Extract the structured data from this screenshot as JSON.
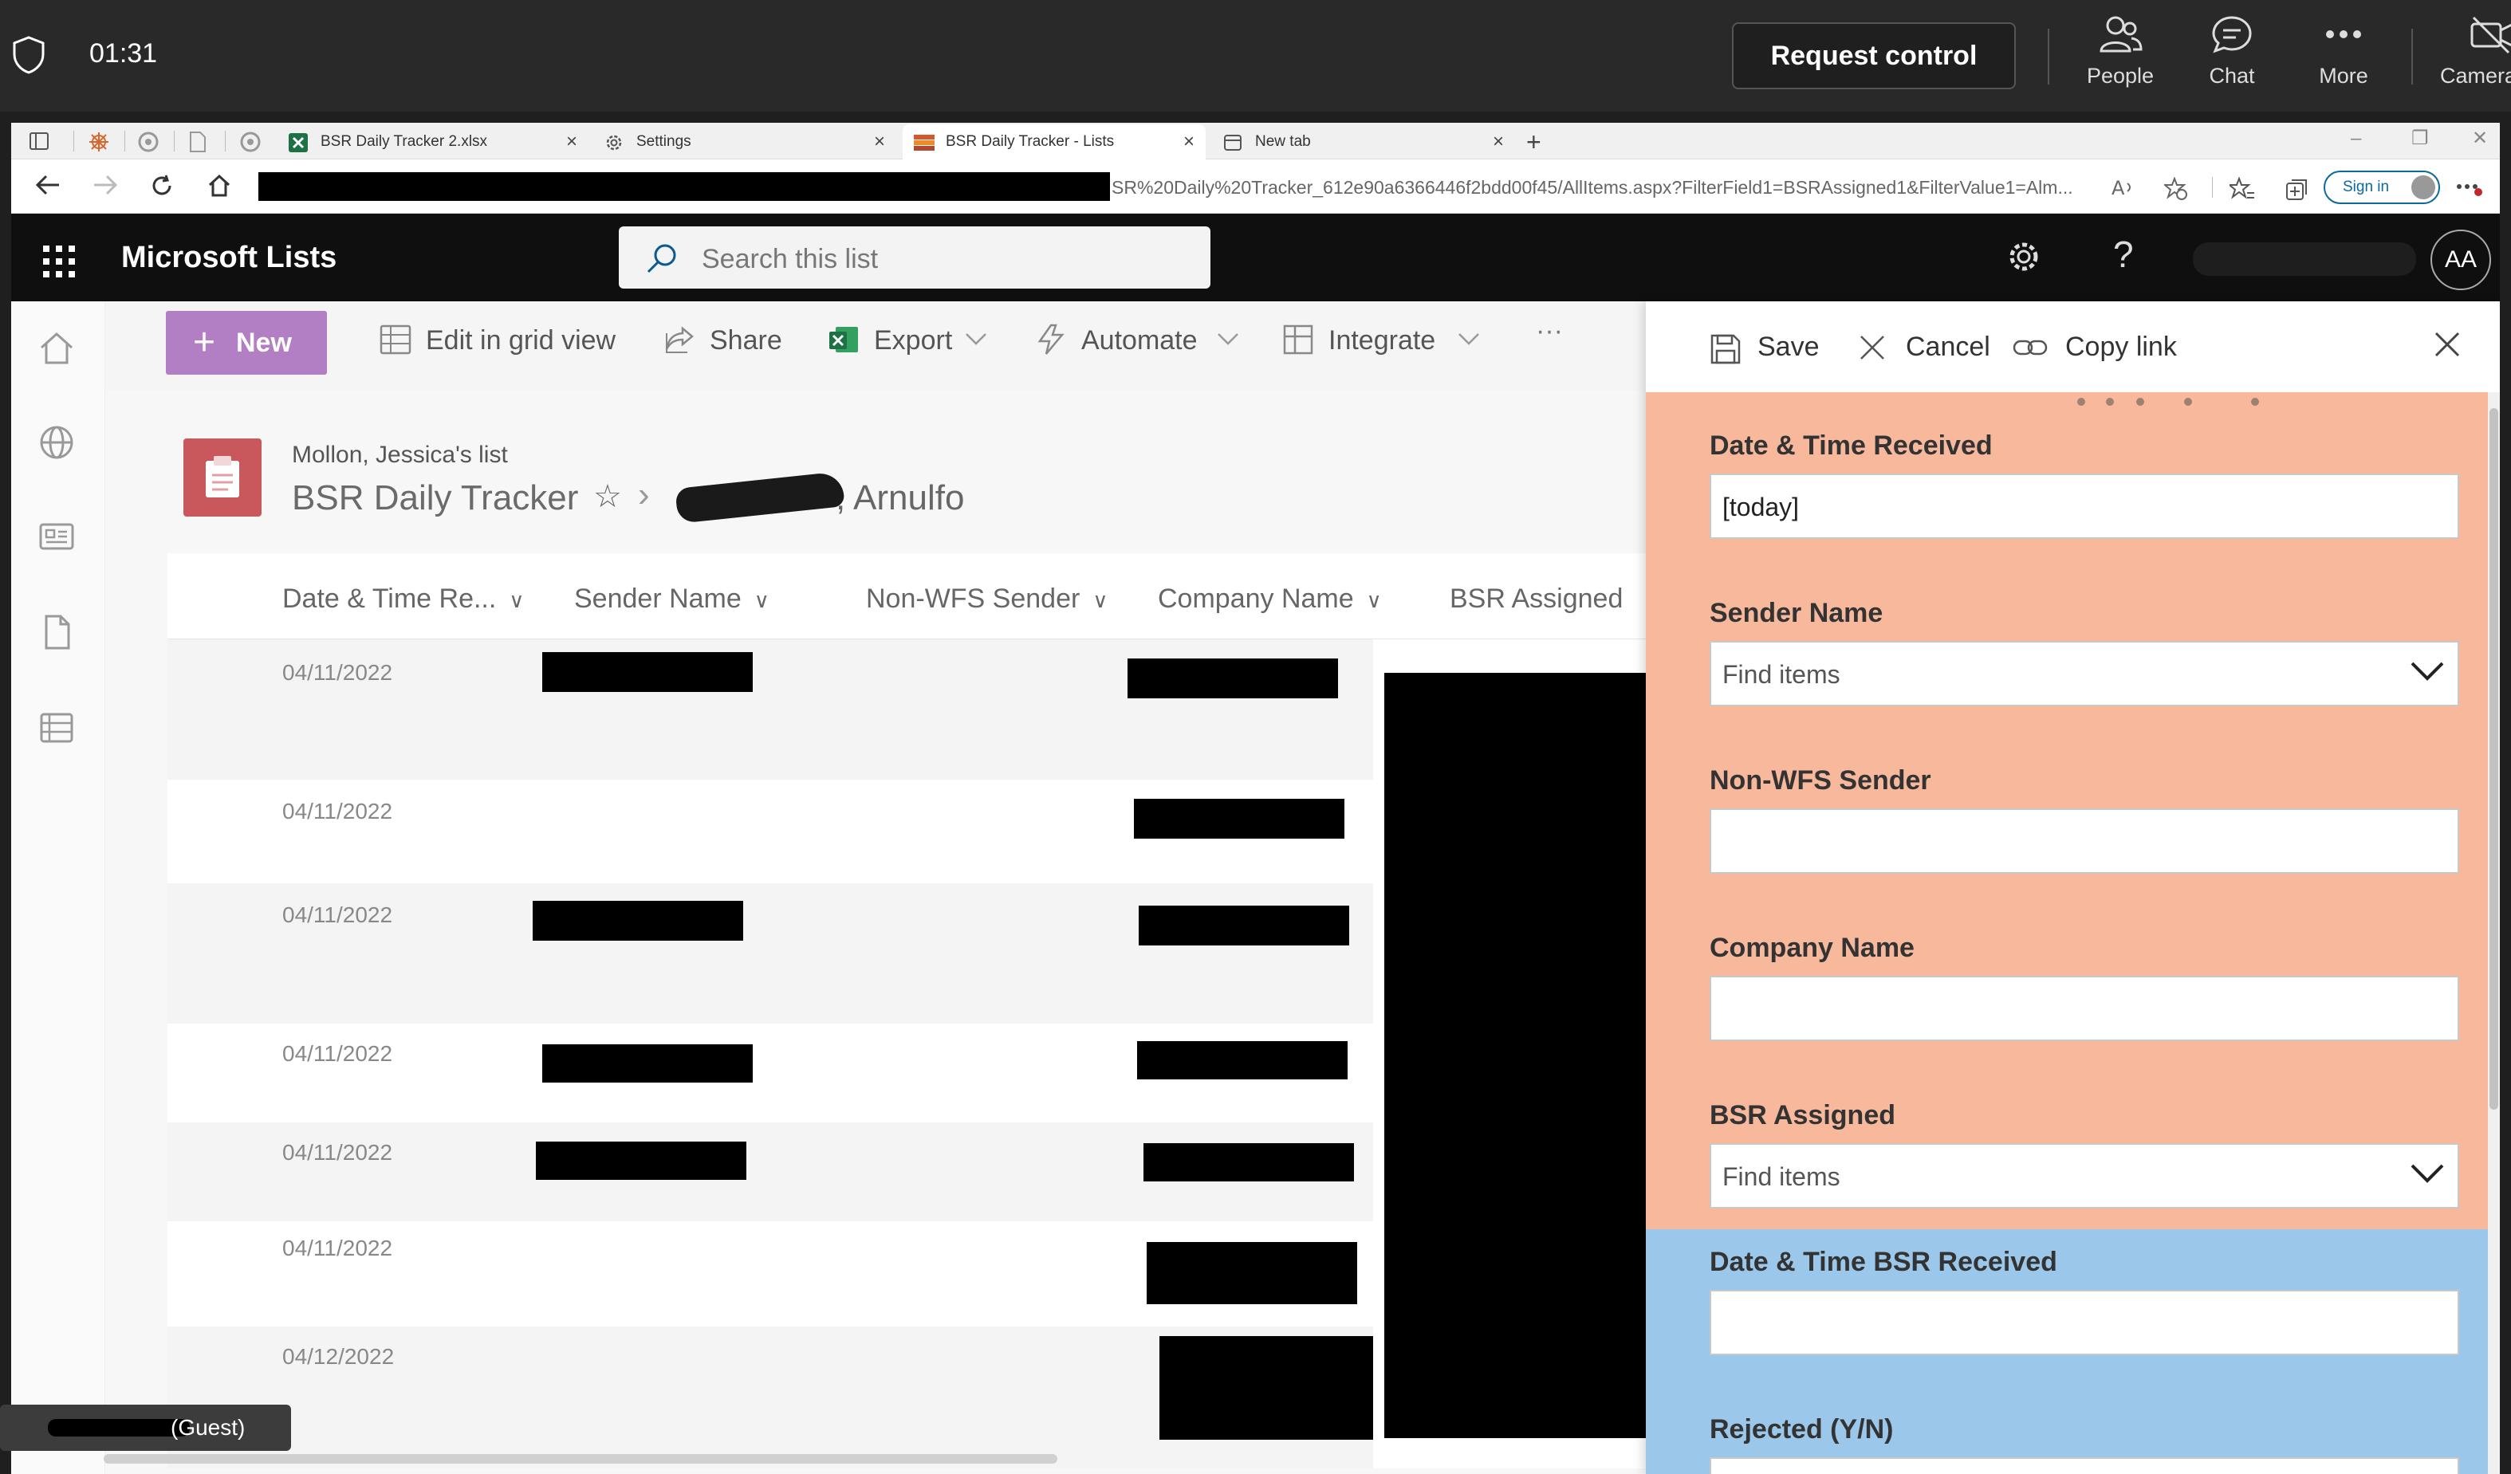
{
  "meeting": {
    "timer": "01:31",
    "request_control": "Request control",
    "tools": [
      {
        "label": "People",
        "icon": "people-icon"
      },
      {
        "label": "Chat",
        "icon": "chat-icon"
      },
      {
        "label": "More",
        "icon": "more-icon"
      },
      {
        "label": "Camera",
        "icon": "camera-off-icon"
      }
    ]
  },
  "browser": {
    "tabs": [
      {
        "label": "BSR Daily Tracker 2.xlsx",
        "icon": "excel-icon"
      },
      {
        "label": "Settings",
        "icon": "gear-icon"
      },
      {
        "label": "BSR Daily Tracker - Lists",
        "icon": "lists-icon",
        "active": true
      },
      {
        "label": "New tab",
        "icon": "newtab-icon"
      }
    ],
    "url_visible": "SR%20Daily%20Tracker_612e90a6366446f2bdd00f45/AllItems.aspx?FilterField1=BSRAssigned1&FilterValue1=Alm...",
    "signin": "Sign in"
  },
  "app": {
    "name": "Microsoft Lists",
    "search_placeholder": "Search this list",
    "avatar_initials": "AA",
    "help": "?"
  },
  "commands": {
    "new": "New",
    "edit_grid": "Edit in grid view",
    "share": "Share",
    "export": "Export",
    "automate": "Automate",
    "integrate": "Integrate",
    "more": "···"
  },
  "list": {
    "owner": "Mollon, Jessica's list",
    "title": "BSR Daily Tracker",
    "folder_suffix": ", Arnulfo",
    "columns": [
      "Date & Time Re...",
      "Sender Name",
      "Non-WFS Sender",
      "Company Name",
      "BSR Assigned"
    ],
    "rows": [
      {
        "date": "04/11/2022"
      },
      {
        "date": "04/11/2022"
      },
      {
        "date": "04/11/2022"
      },
      {
        "date": "04/11/2022"
      },
      {
        "date": "04/11/2022"
      },
      {
        "date": "04/11/2022"
      },
      {
        "date": "04/12/2022"
      }
    ]
  },
  "panel": {
    "save": "Save",
    "cancel": "Cancel",
    "copy_link": "Copy link",
    "section_colors": {
      "primary": "#f7b89c",
      "secondary": "#9bc8ea"
    },
    "fields": [
      {
        "label": "Date & Time Received",
        "value": "[today]",
        "type": "text"
      },
      {
        "label": "Sender Name",
        "placeholder": "Find items",
        "type": "picker"
      },
      {
        "label": "Non-WFS Sender",
        "value": "",
        "type": "text"
      },
      {
        "label": "Company Name",
        "value": "",
        "type": "text"
      },
      {
        "label": "BSR Assigned",
        "placeholder": "Find items",
        "type": "picker"
      },
      {
        "label": "Date & Time BSR Received",
        "value": "",
        "type": "text"
      },
      {
        "label": "Rejected (Y/N)",
        "value": "",
        "type": "text"
      }
    ]
  },
  "guest": {
    "label": "(Guest)"
  }
}
